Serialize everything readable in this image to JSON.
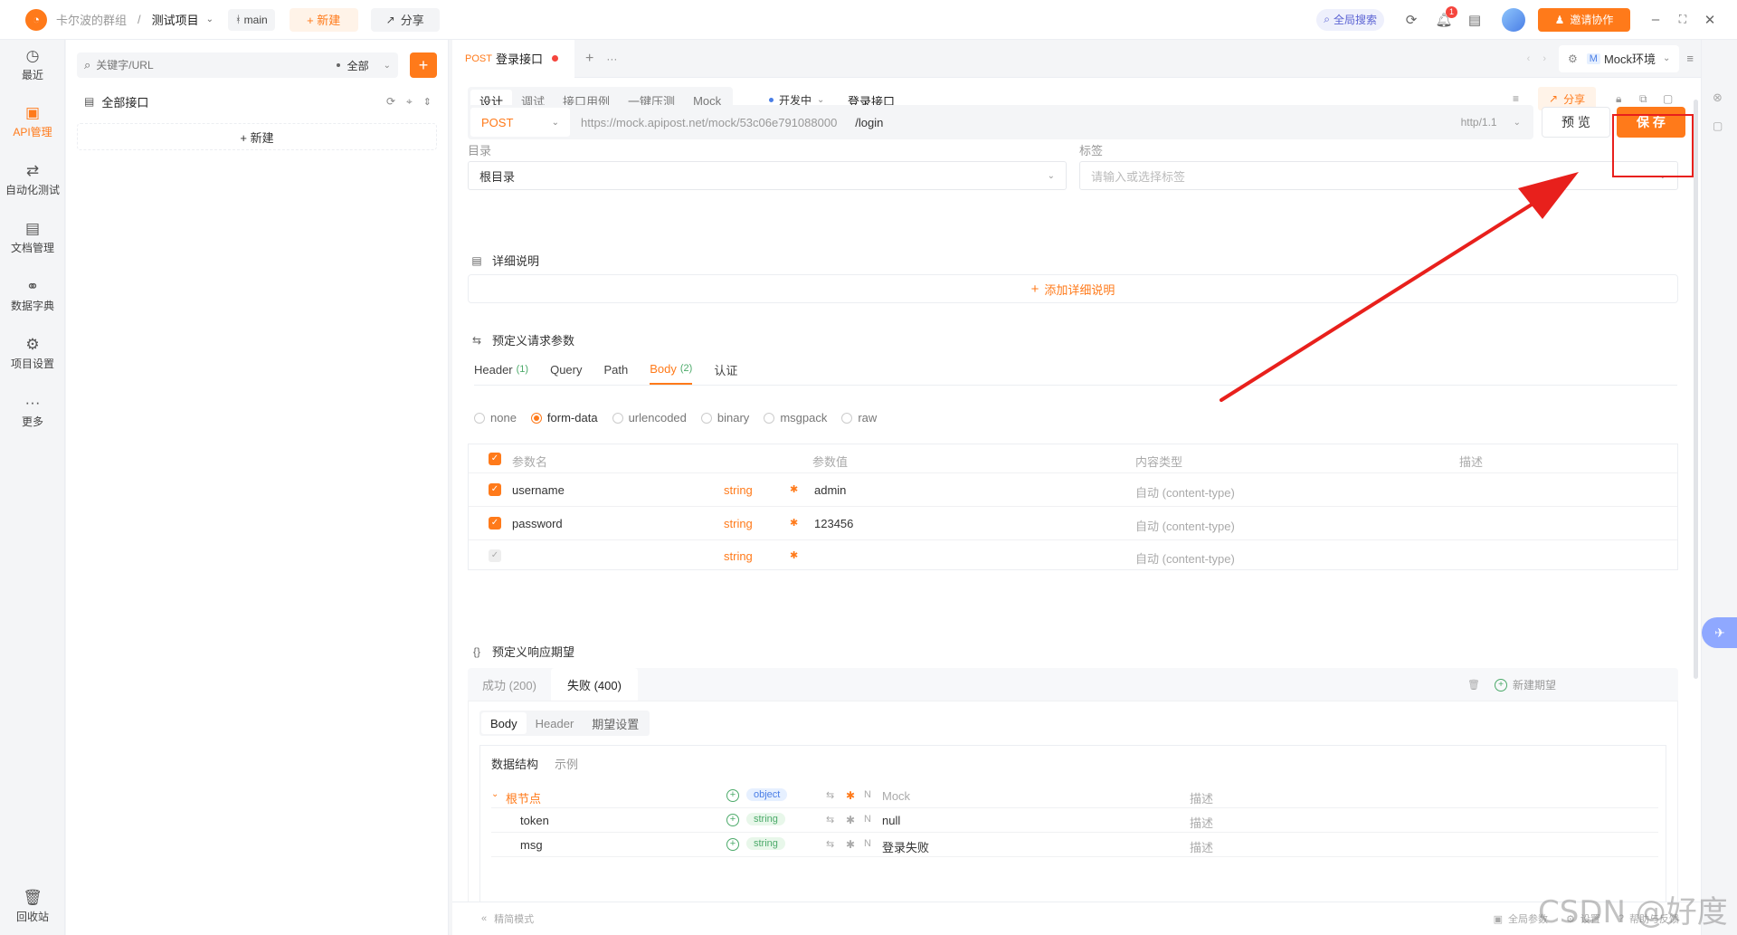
{
  "topbar": {
    "team": "卡尔波的群组",
    "separator": "/",
    "project": "测试项目",
    "branch": "main",
    "new_label": "+ 新建",
    "share_label": "分享",
    "global_search": "全局搜索",
    "notify_count": "1",
    "invite_label": "邀请协作"
  },
  "leftnav": {
    "items": [
      {
        "label": "最近",
        "icon": "clock-icon"
      },
      {
        "label": "API管理",
        "icon": "api-icon"
      },
      {
        "label": "自动化测试",
        "icon": "automation-icon"
      },
      {
        "label": "文档管理",
        "icon": "document-icon"
      },
      {
        "label": "数据字典",
        "icon": "dictionary-icon"
      },
      {
        "label": "项目设置",
        "icon": "settings-icon"
      },
      {
        "label": "更多",
        "icon": "more-icon"
      }
    ],
    "trash": "回收站"
  },
  "sidebar": {
    "search_placeholder": "关键字/URL",
    "filter": "全部",
    "tree_root": "全部接口",
    "new_label": "+ 新建"
  },
  "tab": {
    "method": "POST",
    "title": "登录接口",
    "env": "Mock环境",
    "env_badge": "M"
  },
  "toolbar": {
    "modes": [
      "设计",
      "调试",
      "接口用例",
      "一键压测",
      "Mock"
    ],
    "status": "开发中",
    "name": "登录接口",
    "share": "分享"
  },
  "request": {
    "method": "POST",
    "base_url": "https://mock.apipost.net/mock/53c06e791088000",
    "path": "/login",
    "protocol": "http/1.1",
    "preview": "预 览",
    "save": "保 存"
  },
  "meta": {
    "dir_label": "目录",
    "dir_value": "根目录",
    "tag_label": "标签",
    "tag_placeholder": "请输入或选择标签"
  },
  "detail": {
    "title": "详细说明",
    "add": "添加详细说明"
  },
  "params": {
    "title": "预定义请求参数",
    "tabs": [
      {
        "label": "Header",
        "count": "(1)"
      },
      {
        "label": "Query",
        "count": ""
      },
      {
        "label": "Path",
        "count": ""
      },
      {
        "label": "Body",
        "count": "(2)"
      },
      {
        "label": "认证",
        "count": ""
      }
    ],
    "body_types": [
      "none",
      "form-data",
      "urlencoded",
      "binary",
      "msgpack",
      "raw"
    ],
    "selected_body_type": "form-data",
    "headers": [
      "参数名",
      "参数值",
      "内容类型",
      "描述"
    ],
    "rows": [
      {
        "name": "username",
        "type": "string",
        "value": "admin",
        "content_type": "自动 (content-type)"
      },
      {
        "name": "password",
        "type": "string",
        "value": "123456",
        "content_type": "自动 (content-type)"
      },
      {
        "name": "",
        "type": "string",
        "value": "",
        "content_type": "自动 (content-type)"
      }
    ]
  },
  "response": {
    "title": "预定义响应期望",
    "tabs": [
      "成功 (200)",
      "失败 (400)"
    ],
    "new_expect": "新建期望",
    "subtabs": [
      "Body",
      "Header",
      "期望设置"
    ],
    "struct_tabs": [
      "数据结构",
      "示例"
    ],
    "tree": [
      {
        "name": "根节点",
        "type": "object",
        "mock": "Mock",
        "desc": "描述"
      },
      {
        "name": "token",
        "type": "string",
        "mock": "null",
        "desc": "描述"
      },
      {
        "name": "msg",
        "type": "string",
        "mock": "登录失败",
        "desc": "描述"
      }
    ],
    "n_label": "N"
  },
  "footer": {
    "simple_mode": "精简模式",
    "global_params": "全局参数",
    "settings": "设置",
    "help": "帮助与反馈"
  },
  "watermark": "CSDN @好度",
  "colors": {
    "accent": "#ff7a1a",
    "annotation": "#e8201c"
  }
}
